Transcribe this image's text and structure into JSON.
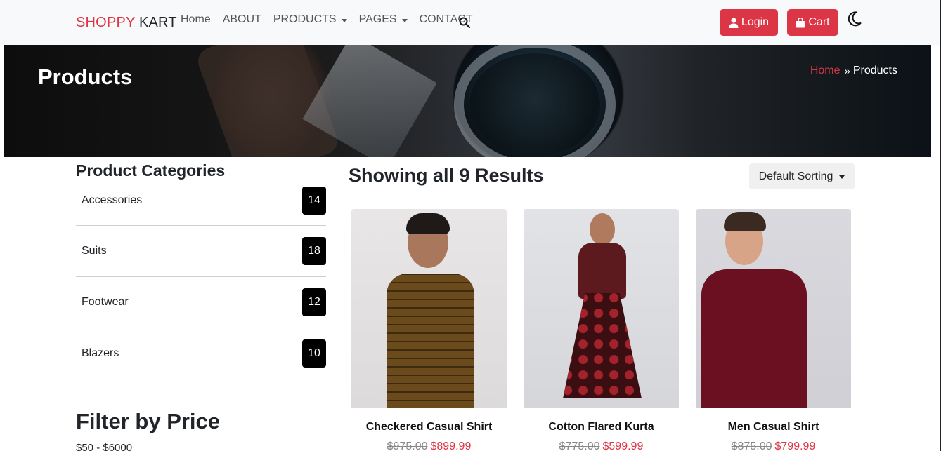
{
  "navbar": {
    "brand_part1": "SHOPPY",
    "brand_part2": "KART",
    "links": [
      {
        "label": "Home",
        "dropdown": false
      },
      {
        "label": "ABOUT",
        "dropdown": false
      },
      {
        "label": "PRODUCTS",
        "dropdown": true
      },
      {
        "label": "PAGES",
        "dropdown": true
      },
      {
        "label": "CONTACT",
        "dropdown": false
      }
    ],
    "search_icon": "search-icon",
    "login_label": "Login",
    "cart_label": "Cart",
    "theme_icon": "moon-icon"
  },
  "hero": {
    "title": "Products",
    "breadcrumb_home": "Home",
    "breadcrumb_current": "Products"
  },
  "sidebar": {
    "categories_title": "Product Categories",
    "categories": [
      {
        "name": "Accessories",
        "count": "14"
      },
      {
        "name": "Suits",
        "count": "18"
      },
      {
        "name": "Footwear",
        "count": "12"
      },
      {
        "name": "Blazers",
        "count": "10"
      }
    ],
    "price_title": "Filter by Price",
    "price_range": "$50 - $6000"
  },
  "main": {
    "results_title": "Showing all 9 Results",
    "sort_label": "Default Sorting",
    "products": [
      {
        "name": "Checkered Casual Shirt",
        "old_price": "$975.00",
        "new_price": "$899.99"
      },
      {
        "name": "Cotton Flared Kurta",
        "old_price": "$775.00",
        "new_price": "$599.99"
      },
      {
        "name": "Men Casual Shirt",
        "old_price": "$875.00",
        "new_price": "$799.99"
      }
    ]
  },
  "colors": {
    "accent": "#dc3545",
    "navbar_bg": "#f8f9fa",
    "badge_bg": "#000000"
  }
}
